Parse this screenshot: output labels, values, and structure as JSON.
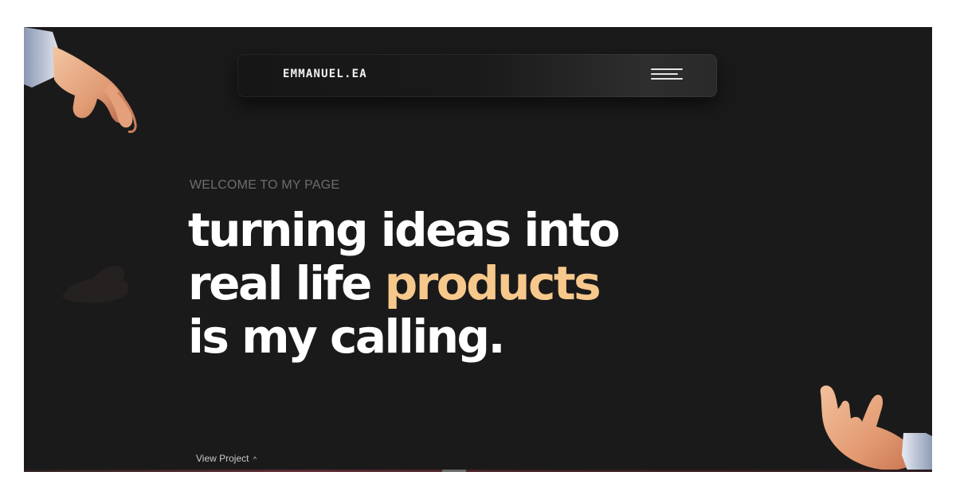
{
  "nav": {
    "brand": "EMMANUEL.EA",
    "menu_icon": "hamburger-menu-icon"
  },
  "hero": {
    "eyebrow": "WELCOME TO MY PAGE",
    "line1": "turning ideas into",
    "line2_start": "real life ",
    "line2_accent": "products",
    "line3": "is my calling."
  },
  "cta": {
    "label": "View Project",
    "caret": "^"
  },
  "colors": {
    "background": "#1b1a1a",
    "accent": "#f7c88c",
    "text": "#ffffff",
    "muted": "#6f6d6b"
  }
}
